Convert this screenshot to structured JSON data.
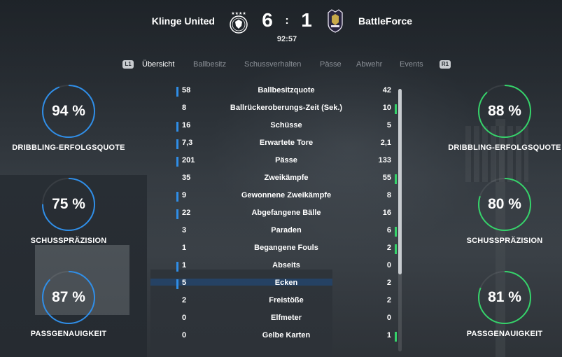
{
  "match": {
    "home_team": "Klinge United",
    "away_team": "BattleForce",
    "home_score": "6",
    "away_score": "1",
    "separator": ":",
    "clock": "92:57"
  },
  "tabs": {
    "left_hint": "L1",
    "right_hint": "R1",
    "items": [
      {
        "label": "Übersicht",
        "active": true
      },
      {
        "label": "Ballbesitz",
        "active": false
      },
      {
        "label": "Schussverhalten",
        "active": false
      },
      {
        "label": "Pässe",
        "active": false
      },
      {
        "label": "Abwehr",
        "active": false
      },
      {
        "label": "Events",
        "active": false
      }
    ]
  },
  "rings": {
    "home": [
      {
        "value": "94 %",
        "label": "DRIBBLING-ERFOLGSQUOTE",
        "percent": 94
      },
      {
        "value": "75 %",
        "label": "SCHUSSPRÄZISION",
        "percent": 75
      },
      {
        "value": "87 %",
        "label": "PASSGENAUIGKEIT",
        "percent": 87
      }
    ],
    "away": [
      {
        "value": "88 %",
        "label": "DRIBBLING-ERFOLGSQUOTE",
        "percent": 88
      },
      {
        "value": "80 %",
        "label": "SCHUSSPRÄZISION",
        "percent": 80
      },
      {
        "value": "81 %",
        "label": "PASSGENAUIGKEIT",
        "percent": 81
      }
    ],
    "home_color": "#2f8ee8",
    "away_color": "#35d36a"
  },
  "stats": {
    "rows": [
      {
        "home": "58",
        "label": "Ballbesitzquote",
        "away": "42",
        "leader": "home"
      },
      {
        "home": "8",
        "label": "Ballrückeroberungs-Zeit (Sek.)",
        "away": "10",
        "leader": "away"
      },
      {
        "home": "16",
        "label": "Schüsse",
        "away": "5",
        "leader": "home"
      },
      {
        "home": "7,3",
        "label": "Erwartete Tore",
        "away": "2,1",
        "leader": "home"
      },
      {
        "home": "201",
        "label": "Pässe",
        "away": "133",
        "leader": "home"
      },
      {
        "home": "35",
        "label": "Zweikämpfe",
        "away": "55",
        "leader": "away"
      },
      {
        "home": "9",
        "label": "Gewonnene Zweikämpfe",
        "away": "8",
        "leader": "home"
      },
      {
        "home": "22",
        "label": "Abgefangene Bälle",
        "away": "16",
        "leader": "home"
      },
      {
        "home": "3",
        "label": "Paraden",
        "away": "6",
        "leader": "away"
      },
      {
        "home": "1",
        "label": "Begangene Fouls",
        "away": "2",
        "leader": "away"
      },
      {
        "home": "1",
        "label": "Abseits",
        "away": "0",
        "leader": "home"
      },
      {
        "home": "5",
        "label": "Ecken",
        "away": "2",
        "leader": "home"
      },
      {
        "home": "2",
        "label": "Freistöße",
        "away": "2",
        "leader": "none"
      },
      {
        "home": "0",
        "label": "Elfmeter",
        "away": "0",
        "leader": "none"
      },
      {
        "home": "0",
        "label": "Gelbe Karten",
        "away": "1",
        "leader": "away"
      }
    ]
  }
}
